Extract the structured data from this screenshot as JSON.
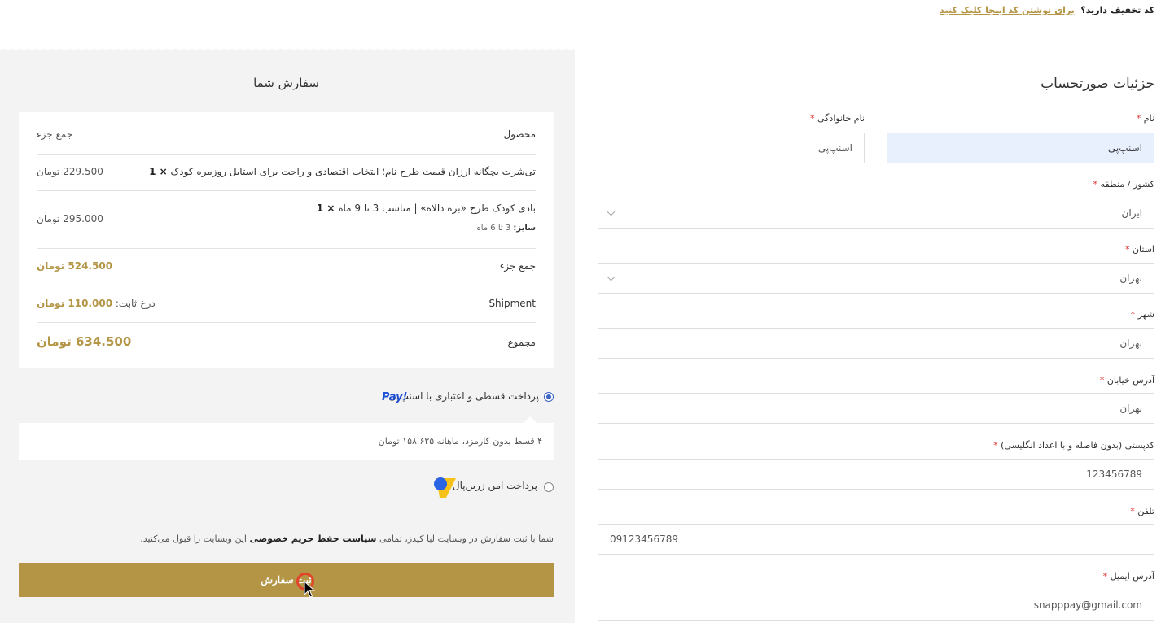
{
  "coupon": {
    "question": "کد تخفیف دارید؟",
    "link_text": "برای نوشتن کد اینجا کلیک کنید"
  },
  "billing": {
    "title": "جزئیات صورتحساب",
    "first_name": {
      "label": "نام",
      "value": "اسنپ‌پی"
    },
    "last_name": {
      "label": "نام خانوادگی",
      "value": "اسنپ‌پی"
    },
    "country": {
      "label": "کشور / منطقه",
      "value": "ایران"
    },
    "state": {
      "label": "استان",
      "value": "تهران"
    },
    "city": {
      "label": "شهر",
      "value": "تهران"
    },
    "street": {
      "label": "آدرس خیابان",
      "value": "تهران"
    },
    "postcode": {
      "label": "کدپستی (بدون فاصله و با اعداد انگلیسی)",
      "value": "123456789"
    },
    "phone": {
      "label": "تلفن",
      "value": "09123456789"
    },
    "email": {
      "label": "آدرس ایمیل",
      "value": "snapppay@gmail.com"
    },
    "required_mark": "*"
  },
  "order": {
    "title": "سفارش شما",
    "head_product": "محصول",
    "head_subtotal": "جمع جزء",
    "items": [
      {
        "name": "تی‌شرت بچگانه ارزان قیمت طرح نام؛ انتخاب اقتصادی و راحت برای استایل روزمره کودک",
        "qty": "× 1",
        "price": "229.500 تومان"
      },
      {
        "name": "بادی کودک طرح «بره دالاه» | مناسب 3 تا 9 ماه",
        "qty": "× 1",
        "size_label": "سایز:",
        "size_value": "3 تا 6 ماه",
        "price": "295.000 تومان"
      }
    ],
    "subtotal_label": "جمع جزء",
    "subtotal_value": "524.500 تومان",
    "shipment_label": "Shipment",
    "shipment_rate_label": "درخ ثابت:",
    "shipment_value": "110.000 تومان",
    "total_label": "مجموع",
    "total_value": "634.500 تومان"
  },
  "payment": {
    "snapppay_label": "پرداخت قسطی و اعتباری با اسنپ‌پی",
    "snapppay_logo": "Pay!",
    "snapppay_desc": "۴ قسط بدون کارمزد، ماهانه ۱۵۸٬۶۲۵ تومان",
    "zarinpal_label": "پرداخت امن زرین‌پال",
    "privacy_prefix": "شما با ثبت سفارش در وبسایت لیا کیدز، تمامی",
    "privacy_link": "سیاست حفظ حریم خصوصی",
    "privacy_suffix": "این وبسایت را قبول می‌کنید.",
    "submit_label": "ثبت سفارش"
  },
  "colors": {
    "accent": "#b39545",
    "required": "#dd3333",
    "panel": "#f3f3f3"
  }
}
